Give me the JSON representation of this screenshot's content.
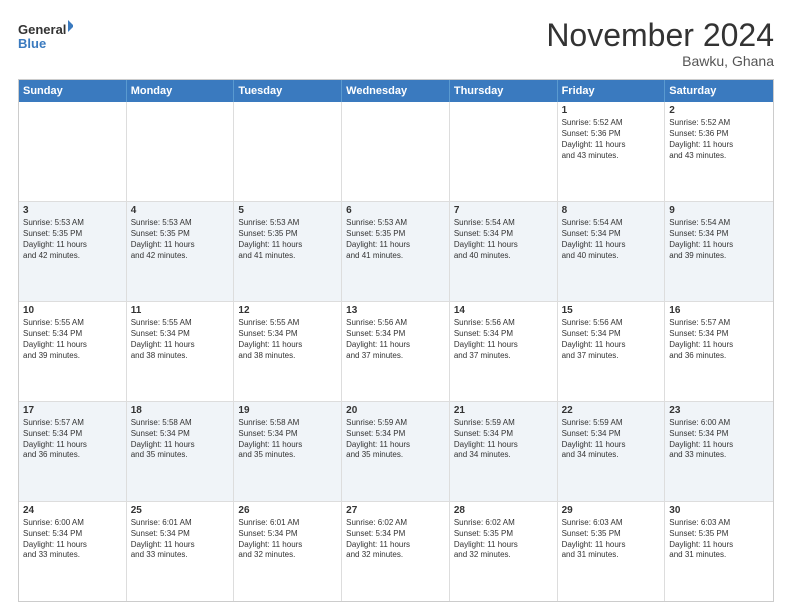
{
  "logo": {
    "line1": "General",
    "line2": "Blue"
  },
  "title": "November 2024",
  "location": "Bawku, Ghana",
  "header_days": [
    "Sunday",
    "Monday",
    "Tuesday",
    "Wednesday",
    "Thursday",
    "Friday",
    "Saturday"
  ],
  "rows": [
    {
      "alt": false,
      "cells": [
        {
          "day": "",
          "text": ""
        },
        {
          "day": "",
          "text": ""
        },
        {
          "day": "",
          "text": ""
        },
        {
          "day": "",
          "text": ""
        },
        {
          "day": "",
          "text": ""
        },
        {
          "day": "1",
          "text": "Sunrise: 5:52 AM\nSunset: 5:36 PM\nDaylight: 11 hours\nand 43 minutes."
        },
        {
          "day": "2",
          "text": "Sunrise: 5:52 AM\nSunset: 5:36 PM\nDaylight: 11 hours\nand 43 minutes."
        }
      ]
    },
    {
      "alt": true,
      "cells": [
        {
          "day": "3",
          "text": "Sunrise: 5:53 AM\nSunset: 5:35 PM\nDaylight: 11 hours\nand 42 minutes."
        },
        {
          "day": "4",
          "text": "Sunrise: 5:53 AM\nSunset: 5:35 PM\nDaylight: 11 hours\nand 42 minutes."
        },
        {
          "day": "5",
          "text": "Sunrise: 5:53 AM\nSunset: 5:35 PM\nDaylight: 11 hours\nand 41 minutes."
        },
        {
          "day": "6",
          "text": "Sunrise: 5:53 AM\nSunset: 5:35 PM\nDaylight: 11 hours\nand 41 minutes."
        },
        {
          "day": "7",
          "text": "Sunrise: 5:54 AM\nSunset: 5:34 PM\nDaylight: 11 hours\nand 40 minutes."
        },
        {
          "day": "8",
          "text": "Sunrise: 5:54 AM\nSunset: 5:34 PM\nDaylight: 11 hours\nand 40 minutes."
        },
        {
          "day": "9",
          "text": "Sunrise: 5:54 AM\nSunset: 5:34 PM\nDaylight: 11 hours\nand 39 minutes."
        }
      ]
    },
    {
      "alt": false,
      "cells": [
        {
          "day": "10",
          "text": "Sunrise: 5:55 AM\nSunset: 5:34 PM\nDaylight: 11 hours\nand 39 minutes."
        },
        {
          "day": "11",
          "text": "Sunrise: 5:55 AM\nSunset: 5:34 PM\nDaylight: 11 hours\nand 38 minutes."
        },
        {
          "day": "12",
          "text": "Sunrise: 5:55 AM\nSunset: 5:34 PM\nDaylight: 11 hours\nand 38 minutes."
        },
        {
          "day": "13",
          "text": "Sunrise: 5:56 AM\nSunset: 5:34 PM\nDaylight: 11 hours\nand 37 minutes."
        },
        {
          "day": "14",
          "text": "Sunrise: 5:56 AM\nSunset: 5:34 PM\nDaylight: 11 hours\nand 37 minutes."
        },
        {
          "day": "15",
          "text": "Sunrise: 5:56 AM\nSunset: 5:34 PM\nDaylight: 11 hours\nand 37 minutes."
        },
        {
          "day": "16",
          "text": "Sunrise: 5:57 AM\nSunset: 5:34 PM\nDaylight: 11 hours\nand 36 minutes."
        }
      ]
    },
    {
      "alt": true,
      "cells": [
        {
          "day": "17",
          "text": "Sunrise: 5:57 AM\nSunset: 5:34 PM\nDaylight: 11 hours\nand 36 minutes."
        },
        {
          "day": "18",
          "text": "Sunrise: 5:58 AM\nSunset: 5:34 PM\nDaylight: 11 hours\nand 35 minutes."
        },
        {
          "day": "19",
          "text": "Sunrise: 5:58 AM\nSunset: 5:34 PM\nDaylight: 11 hours\nand 35 minutes."
        },
        {
          "day": "20",
          "text": "Sunrise: 5:59 AM\nSunset: 5:34 PM\nDaylight: 11 hours\nand 35 minutes."
        },
        {
          "day": "21",
          "text": "Sunrise: 5:59 AM\nSunset: 5:34 PM\nDaylight: 11 hours\nand 34 minutes."
        },
        {
          "day": "22",
          "text": "Sunrise: 5:59 AM\nSunset: 5:34 PM\nDaylight: 11 hours\nand 34 minutes."
        },
        {
          "day": "23",
          "text": "Sunrise: 6:00 AM\nSunset: 5:34 PM\nDaylight: 11 hours\nand 33 minutes."
        }
      ]
    },
    {
      "alt": false,
      "cells": [
        {
          "day": "24",
          "text": "Sunrise: 6:00 AM\nSunset: 5:34 PM\nDaylight: 11 hours\nand 33 minutes."
        },
        {
          "day": "25",
          "text": "Sunrise: 6:01 AM\nSunset: 5:34 PM\nDaylight: 11 hours\nand 33 minutes."
        },
        {
          "day": "26",
          "text": "Sunrise: 6:01 AM\nSunset: 5:34 PM\nDaylight: 11 hours\nand 32 minutes."
        },
        {
          "day": "27",
          "text": "Sunrise: 6:02 AM\nSunset: 5:34 PM\nDaylight: 11 hours\nand 32 minutes."
        },
        {
          "day": "28",
          "text": "Sunrise: 6:02 AM\nSunset: 5:35 PM\nDaylight: 11 hours\nand 32 minutes."
        },
        {
          "day": "29",
          "text": "Sunrise: 6:03 AM\nSunset: 5:35 PM\nDaylight: 11 hours\nand 31 minutes."
        },
        {
          "day": "30",
          "text": "Sunrise: 6:03 AM\nSunset: 5:35 PM\nDaylight: 11 hours\nand 31 minutes."
        }
      ]
    }
  ]
}
